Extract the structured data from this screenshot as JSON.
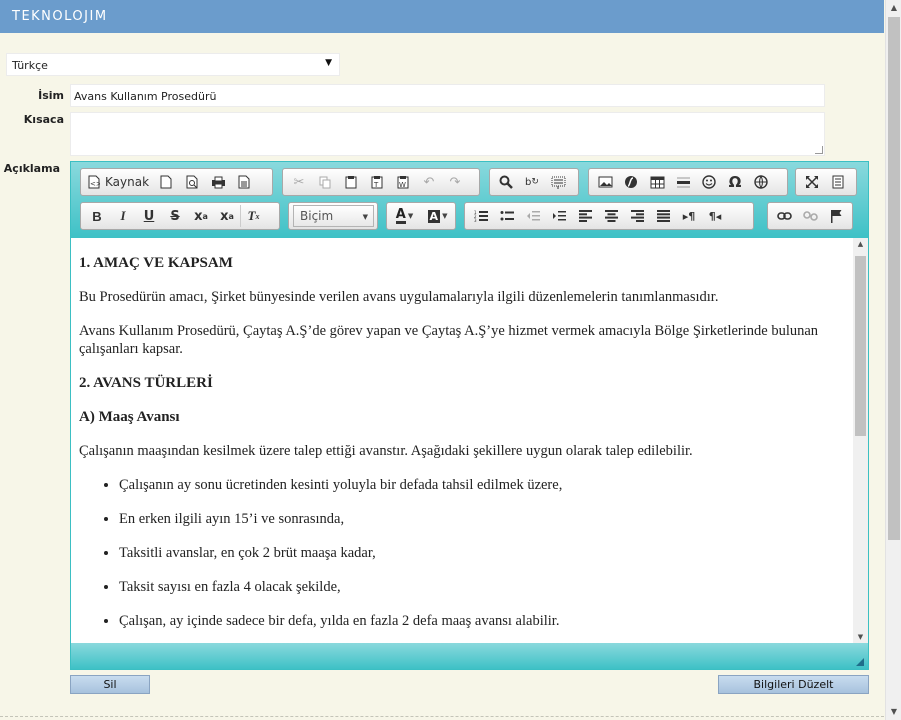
{
  "header": {
    "logo": "TEKNOLOJIM",
    "bg_color": "#6b9ccc"
  },
  "language": {
    "selected": "Türkçe"
  },
  "form": {
    "name_label": "İsim",
    "name_value": "Avans Kullanım Prosedürü",
    "summary_label": "Kısaca",
    "summary_value": "",
    "description_label": "Açıklama"
  },
  "editor": {
    "accent_color": "#3ec1c6",
    "toolbar": {
      "source_label": "Kaynak",
      "format_label": "Biçim",
      "row1_icons": [
        "source-icon",
        "new-page-icon",
        "preview-icon",
        "print-icon",
        "templates-icon",
        "cut-icon",
        "copy-icon",
        "paste-icon",
        "paste-text-icon",
        "paste-word-icon",
        "undo-icon",
        "redo-icon",
        "find-icon",
        "replace-icon",
        "select-all-icon",
        "image-icon",
        "flash-icon",
        "table-icon",
        "horizontal-line-icon",
        "smiley-icon",
        "special-char-icon",
        "iframe-icon",
        "maximize-icon",
        "show-blocks-icon"
      ],
      "row2_icons": [
        "bold-icon",
        "italic-icon",
        "underline-icon",
        "strike-icon",
        "subscript-icon",
        "superscript-icon",
        "remove-format-icon",
        "text-color-icon",
        "bg-color-icon",
        "numbered-list-icon",
        "bulleted-list-icon",
        "outdent-icon",
        "indent-icon",
        "align-left-icon",
        "align-center-icon",
        "align-right-icon",
        "justify-icon",
        "ltr-icon",
        "rtl-icon",
        "link-icon",
        "unlink-icon",
        "anchor-icon"
      ]
    },
    "content": {
      "heading1": "1. AMAÇ VE KAPSAM",
      "para1": "Bu Prosedürün amacı, Şirket bünyesinde verilen avans uygulamalarıyla ilgili düzenlemelerin tanımlanmasıdır.",
      "para2": "Avans Kullanım Prosedürü, Çaytaş A.Ş’de görev yapan ve Çaytaş A.Ş’ye hizmet vermek amacıyla Bölge Şirketlerinde bulunan çalışanları kapsar.",
      "heading2": "2. AVANS TÜRLERİ",
      "heading3": "A) Maaş Avansı",
      "para3": "Çalışanın maaşından kesilmek üzere talep ettiği avanstır. Aşağıdaki şekillere uygun olarak talep edilebilir.",
      "bullets": [
        "Çalışanın ay sonu ücretinden kesinti yoluyla bir defada tahsil edilmek üzere,",
        "En erken ilgili ayın 15’i ve sonrasında,",
        "Taksitli avanslar, en çok 2 brüt maaşa kadar,",
        "Taksit sayısı en fazla 4 olacak şekilde,",
        "Çalışan, ay içinde sadece bir defa, yılda en fazla 2 defa maaş avansı alabilir."
      ]
    }
  },
  "actions": {
    "delete_label": "Sil",
    "update_label": "Bilgileri Düzelt"
  }
}
